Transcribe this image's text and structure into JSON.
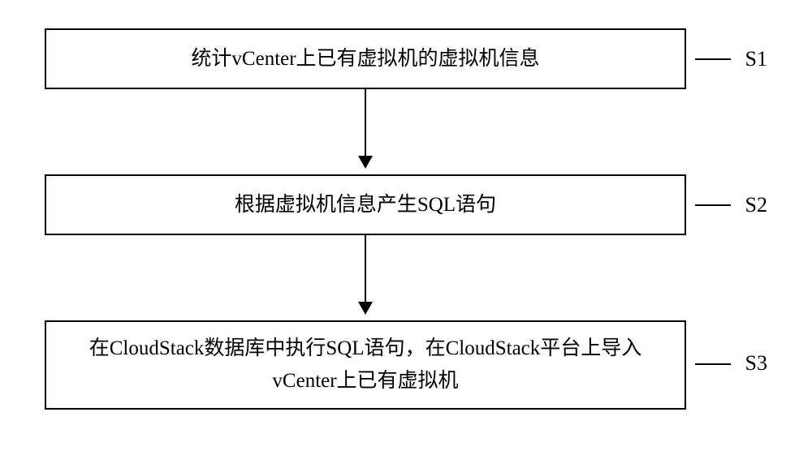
{
  "flowchart": {
    "steps": [
      {
        "id": "s1",
        "label": "S1",
        "text": "统计vCenter上已有虚拟机的虚拟机信息"
      },
      {
        "id": "s2",
        "label": "S2",
        "text": "根据虚拟机信息产生SQL语句"
      },
      {
        "id": "s3",
        "label": "S3",
        "text": "在CloudStack数据库中执行SQL语句，在CloudStack平台上导入vCenter上已有虚拟机"
      }
    ]
  }
}
